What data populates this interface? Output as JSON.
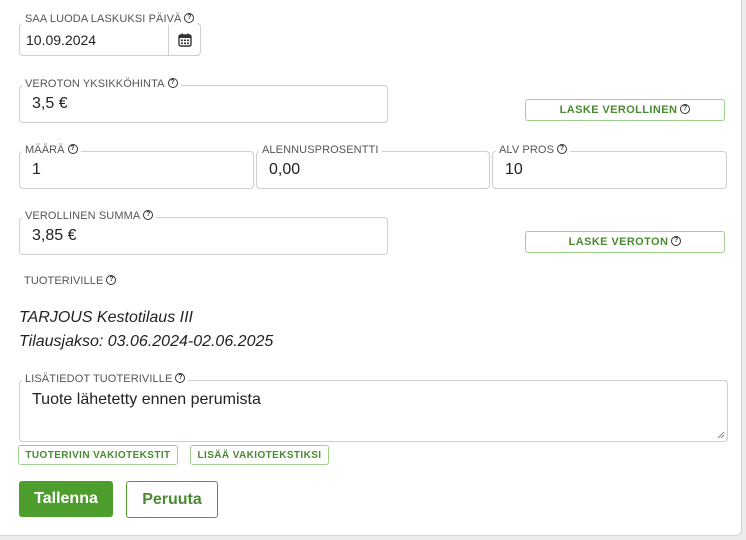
{
  "invoice_date": {
    "label": "SAA LUODA LASKUKSI PÄIVÄ",
    "value": "10.09.2024",
    "icon": "calendar-icon"
  },
  "unit_price": {
    "label": "VEROTON YKSIKKÖHINTA",
    "value": "3,5 €"
  },
  "calc_taxed_button": "LASKE VEROLLINEN",
  "quantity": {
    "label": "MÄÄRÄ",
    "value": "1"
  },
  "discount": {
    "label": "ALENNUSPROSENTTI",
    "value": "0,00"
  },
  "vat": {
    "label": "ALV PROS",
    "value": "10"
  },
  "taxed_sum": {
    "label": "VEROLLINEN SUMMA",
    "value": "3,85 €"
  },
  "calc_untaxed_button": "LASKE VEROTON",
  "product_rows_label": "TUOTERIVILLE",
  "product_lines": [
    "TARJOUS Kestotilaus III",
    "Tilausjakso: 03.06.2024-02.06.2025"
  ],
  "extra_info": {
    "label": "LISÄTIEDOT TUOTERIVILLE",
    "value": "Tuote lähetetty ennen perumista"
  },
  "standard_texts_button": "TUOTERIVIN VAKIOTEKSTIT",
  "add_standard_text_button": "LISÄÄ VAKIOTEKSTIKSI",
  "save_button": "Tallenna",
  "cancel_button": "Peruuta",
  "colors": {
    "primary": "#4e9e2e",
    "accent_border": "#9fd08f",
    "accent_text": "#4a8a32"
  }
}
